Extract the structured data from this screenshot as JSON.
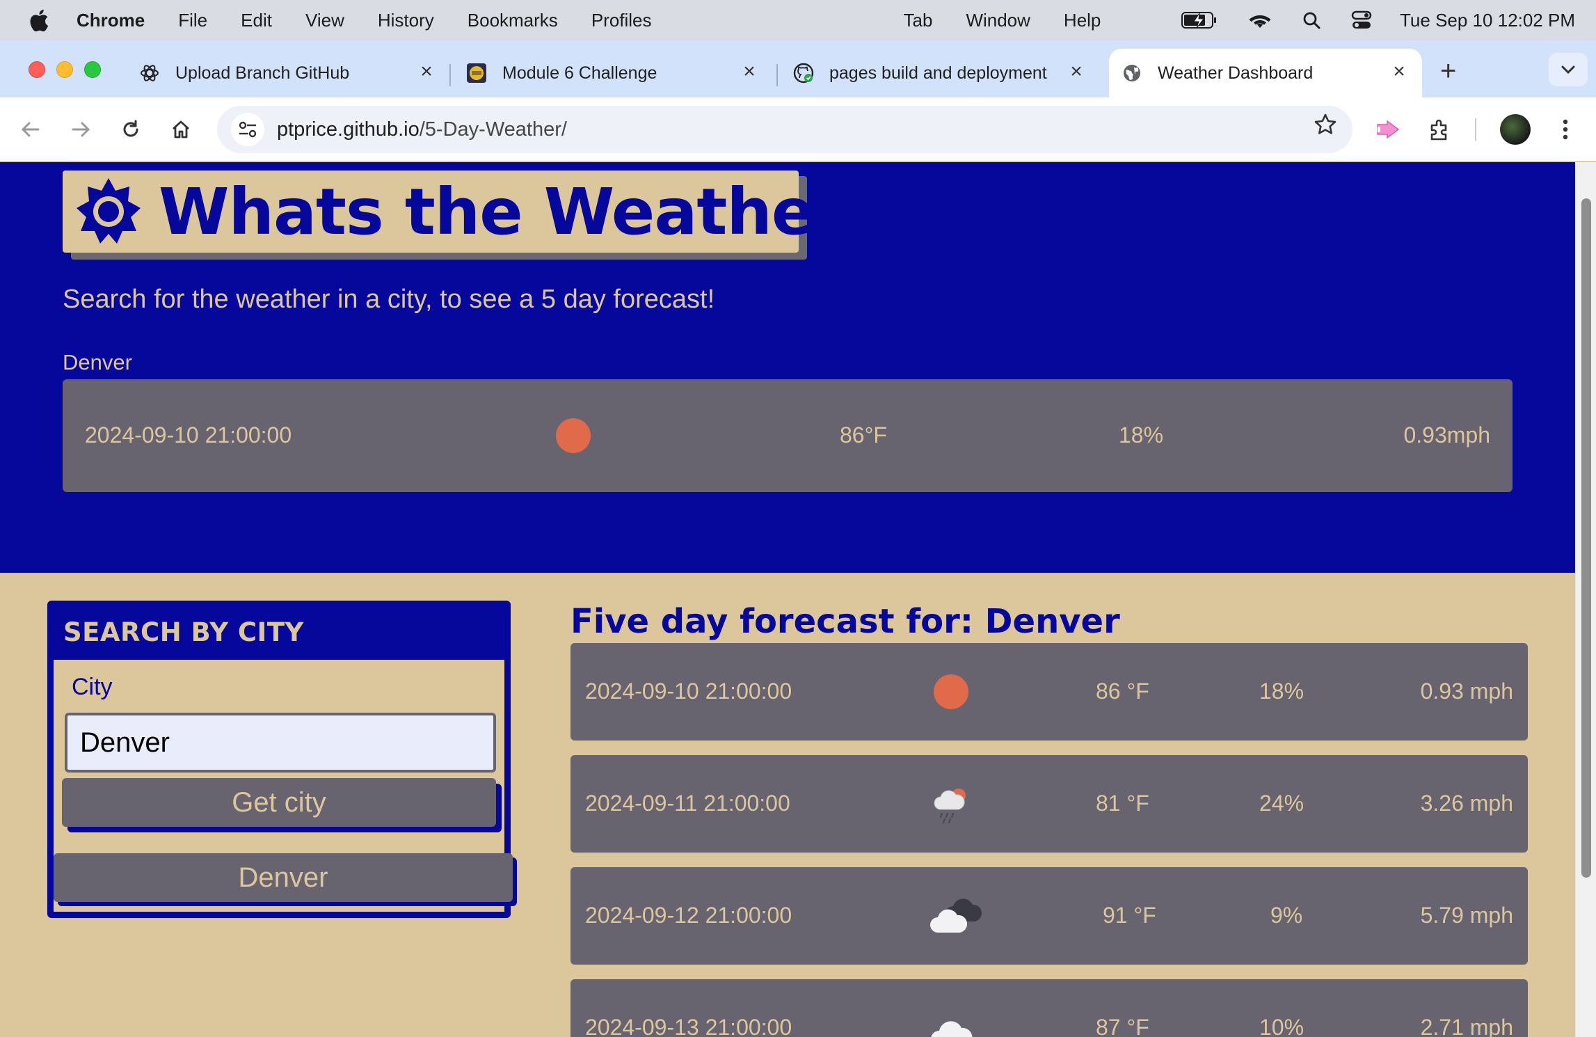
{
  "menubar": {
    "app": "Chrome",
    "items": [
      "File",
      "Edit",
      "View",
      "History",
      "Bookmarks",
      "Profiles",
      "Tab",
      "Window",
      "Help"
    ],
    "clock": "Tue Sep 10  12:02 PM"
  },
  "tabs": [
    {
      "label": "Upload Branch GitHub",
      "icon": "openai-icon"
    },
    {
      "label": "Module 6 Challenge",
      "icon": "course-icon"
    },
    {
      "label": "pages build and deployment",
      "icon": "github-icon"
    },
    {
      "label": "Weather Dashboard",
      "icon": "globe-icon",
      "active": true
    }
  ],
  "toolbar": {
    "url_host": "ptprice.github.io",
    "url_path": "/5-Day-Weather/"
  },
  "page": {
    "title": "Whats the Weather!",
    "subtitle": "Search for the weather in a city, to see a 5 day forecast!",
    "current": {
      "city": "Denver",
      "datetime": "2024-09-10 21:00:00",
      "icon": "clear-sun-icon",
      "temp": "86°F",
      "humidity": "18%",
      "wind": "0.93mph"
    },
    "search": {
      "heading": "SEARCH BY CITY",
      "city_label": "City",
      "city_value": "Denver",
      "submit_label": "Get city",
      "history": [
        "Denver"
      ]
    },
    "forecast": {
      "title": "Five day forecast for: Denver",
      "rows": [
        {
          "datetime": "2024-09-10 21:00:00",
          "icon": "clear-sun-icon",
          "temp": "86 °F",
          "humidity": "18%",
          "wind": "0.93 mph"
        },
        {
          "datetime": "2024-09-11 21:00:00",
          "icon": "rain-sun-icon",
          "temp": "81 °F",
          "humidity": "24%",
          "wind": "3.26 mph"
        },
        {
          "datetime": "2024-09-12 21:00:00",
          "icon": "cloudy-icon",
          "temp": "91 °F",
          "humidity": "9%",
          "wind": "5.79 mph"
        },
        {
          "datetime": "2024-09-13 21:00:00",
          "icon": "cloud-icon",
          "temp": "87 °F",
          "humidity": "10%",
          "wind": "2.71 mph"
        }
      ]
    }
  },
  "colors": {
    "navy": "#05089a",
    "tan": "#dcc69c",
    "card": "#67646f",
    "sun": "#e06a4a"
  }
}
